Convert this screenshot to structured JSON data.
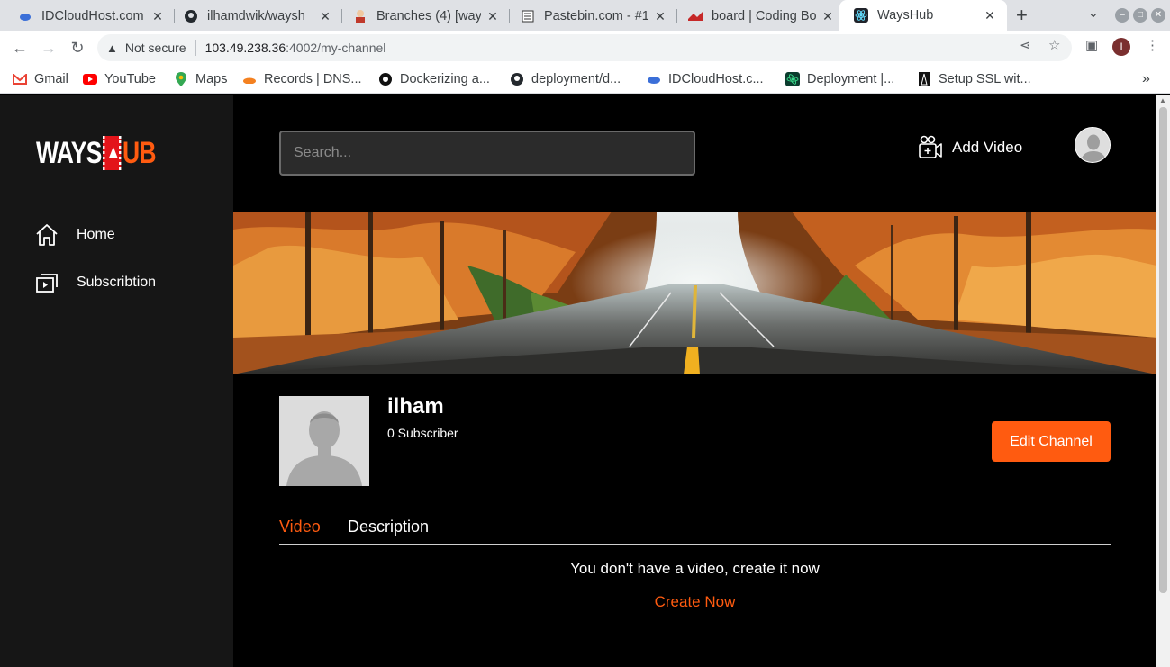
{
  "browser": {
    "tabs": [
      {
        "title": "IDCloudHost.com",
        "icon": "cloud-icon",
        "active": false
      },
      {
        "title": "ilhamdwik/waysh",
        "icon": "github-icon",
        "active": false
      },
      {
        "title": "Branches (4) [way",
        "icon": "gitlab-avatar-icon",
        "active": false
      },
      {
        "title": "Pastebin.com - #1",
        "icon": "pastebin-icon",
        "active": false
      },
      {
        "title": "board | Coding Bo",
        "icon": "board-icon",
        "active": false
      },
      {
        "title": "WaysHub",
        "icon": "react-icon",
        "active": true
      }
    ],
    "new_tab_label": "+",
    "security_label": "Not secure",
    "url_host": "103.49.238.36",
    "url_path": ":4002/my-channel",
    "profile_initial": "I",
    "bookmarks": [
      {
        "label": "Gmail",
        "icon": "gmail-icon"
      },
      {
        "label": "YouTube",
        "icon": "youtube-icon"
      },
      {
        "label": "Maps",
        "icon": "maps-icon"
      },
      {
        "label": "Records | DNS...",
        "icon": "cloudflare-icon"
      },
      {
        "label": "Dockerizing a...",
        "icon": "docker-circle-icon"
      },
      {
        "label": "deployment/d...",
        "icon": "github-icon"
      },
      {
        "label": "IDCloudHost.c...",
        "icon": "cloud-icon"
      },
      {
        "label": "Deployment |...",
        "icon": "react-icon"
      },
      {
        "label": "Setup SSL wit...",
        "icon": "tower-icon"
      }
    ],
    "bookmarks_overflow": "»"
  },
  "app": {
    "logo": {
      "part1": "WAYS",
      "part2": "UB"
    },
    "sidebar": {
      "items": [
        {
          "label": "Home",
          "icon": "home-icon"
        },
        {
          "label": "Subscribtion",
          "icon": "subscription-icon"
        }
      ]
    },
    "header": {
      "search_placeholder": "Search...",
      "add_video_label": "Add Video"
    },
    "channel": {
      "name": "ilham",
      "subscribers": "0 Subscriber",
      "edit_label": "Edit Channel",
      "tabs": [
        {
          "label": "Video",
          "active": true
        },
        {
          "label": "Description",
          "active": false
        }
      ],
      "empty_message": "You don't have a video, create it now",
      "create_label": "Create Now"
    },
    "colors": {
      "accent": "#ff5b10",
      "sidebar_bg": "#161616",
      "main_bg": "#000000"
    }
  }
}
